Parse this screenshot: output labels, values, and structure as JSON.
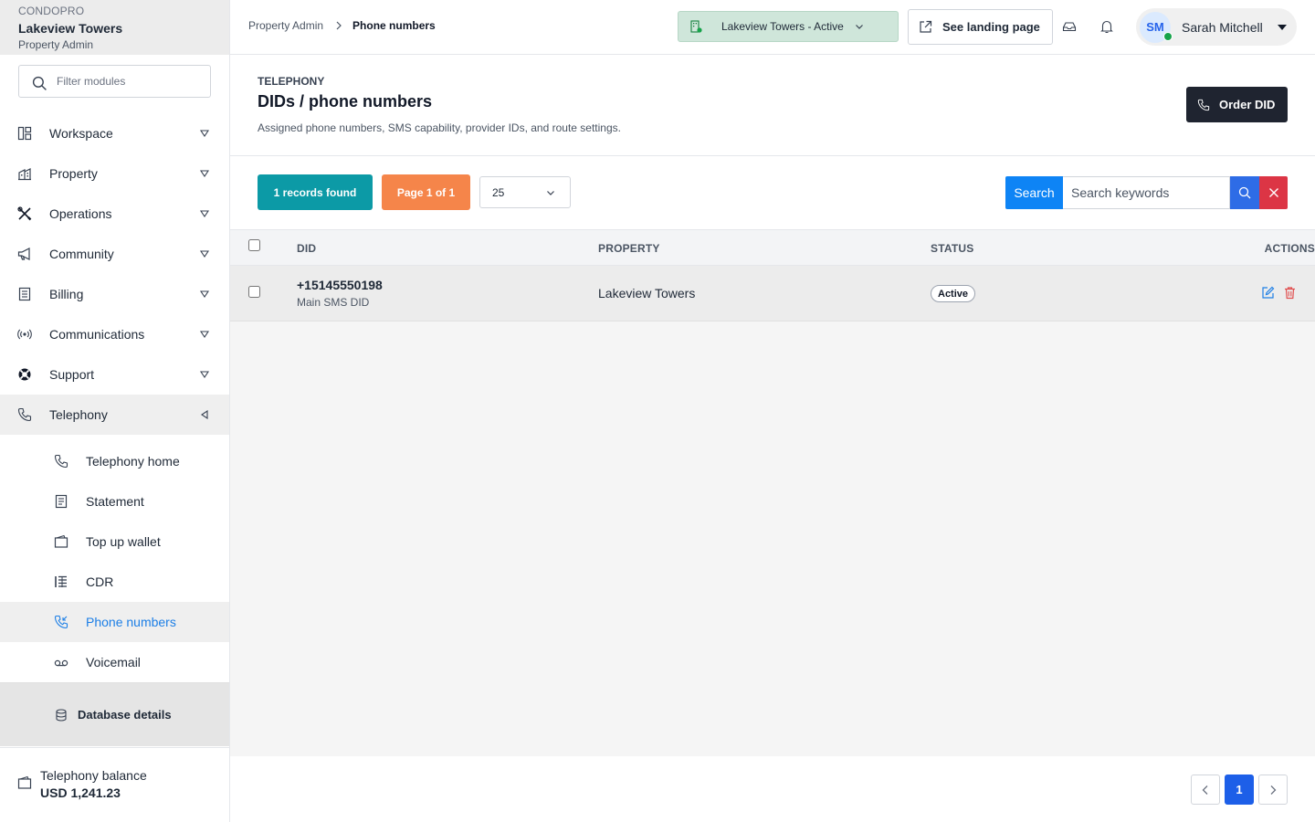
{
  "brand": {
    "org": "CONDOPRO",
    "property": "Lakeview Towers",
    "role": "Property Admin"
  },
  "sidebar": {
    "filter_placeholder": "Filter modules",
    "items": [
      {
        "label": "Workspace",
        "icon": "layout-grid-icon"
      },
      {
        "label": "Property",
        "icon": "building-icon"
      },
      {
        "label": "Operations",
        "icon": "tools-icon"
      },
      {
        "label": "Community",
        "icon": "megaphone-icon"
      },
      {
        "label": "Billing",
        "icon": "receipt-icon"
      },
      {
        "label": "Communications",
        "icon": "broadcast-icon"
      },
      {
        "label": "Support",
        "icon": "lifebuoy-icon"
      },
      {
        "label": "Telephony",
        "icon": "phone-icon"
      }
    ],
    "telephony_sub": [
      {
        "label": "Telephony home",
        "icon": "phone-icon"
      },
      {
        "label": "Statement",
        "icon": "document-icon"
      },
      {
        "label": "Top up wallet",
        "icon": "wallet-icon"
      },
      {
        "label": "CDR",
        "icon": "list-icon"
      },
      {
        "label": "Phone numbers",
        "icon": "phone-incoming-icon"
      },
      {
        "label": "Voicemail",
        "icon": "voicemail-icon"
      }
    ],
    "database_details": "Database details",
    "balance_label": "Telephony balance",
    "balance_value": "USD 1,241.23"
  },
  "topbar": {
    "breadcrumb_parent": "Property Admin",
    "breadcrumb_current": "Phone numbers",
    "property_selector": "Lakeview Towers - Active",
    "landing_button": "See landing page",
    "user_initials": "SM",
    "user_name": "Sarah Mitchell"
  },
  "header": {
    "section": "TELEPHONY",
    "title": "DIDs / phone numbers",
    "description": "Assigned phone numbers, SMS capability, provider IDs, and route settings.",
    "order_button": "Order DID"
  },
  "toolbar": {
    "records": "1 records found",
    "page": "Page 1 of 1",
    "per_page": "25",
    "search_label": "Search",
    "search_placeholder": "Search keywords"
  },
  "table": {
    "columns": [
      "DID",
      "PROPERTY",
      "STATUS",
      "ACTIONS"
    ],
    "rows": [
      {
        "did": "+15145550198",
        "did_note": "Main SMS DID",
        "property": "Lakeview Towers",
        "status": "Active"
      }
    ]
  },
  "pagination": {
    "current": "1"
  },
  "colors": {
    "accent_blue": "#0e84f5",
    "teal": "#0c9aa6",
    "orange": "#f5854a",
    "danger": "#dc3545",
    "dark": "#1f2430"
  }
}
